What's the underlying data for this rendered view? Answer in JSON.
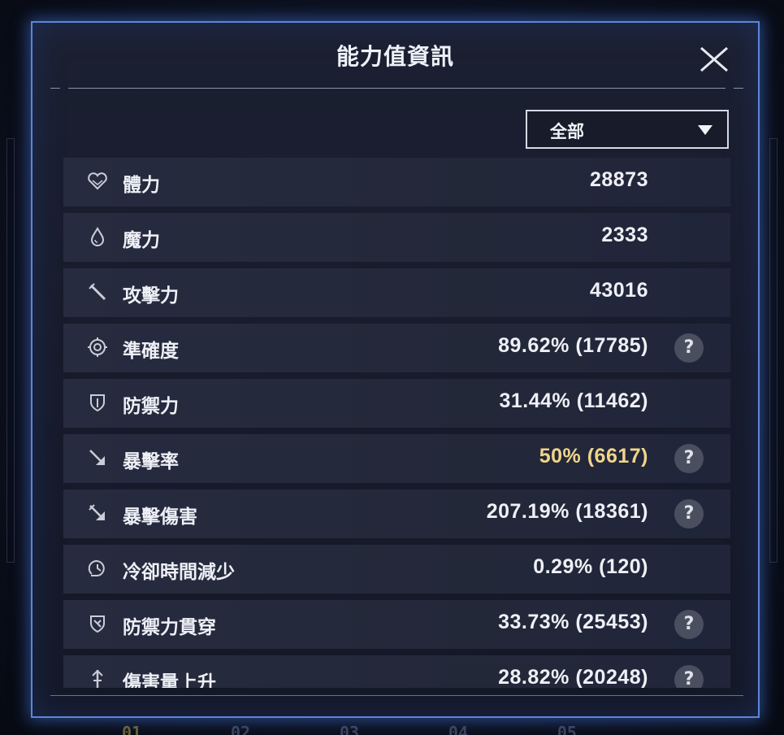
{
  "background": {
    "bottom_tab_numbers": [
      "01",
      "02",
      "03",
      "04",
      "05"
    ]
  },
  "panel": {
    "title": "能力值資訊",
    "close_icon": "close-x-icon"
  },
  "filter": {
    "selected": "全部",
    "arrow_icon": "triangle-down-icon"
  },
  "stats": [
    {
      "icon": "heart-icon",
      "label": "體力",
      "value": "28873",
      "help": false,
      "highlight": false
    },
    {
      "icon": "droplet-icon",
      "label": "魔力",
      "value": "2333",
      "help": false,
      "highlight": false
    },
    {
      "icon": "sword-icon",
      "label": "攻擊力",
      "value": "43016",
      "help": false,
      "highlight": false
    },
    {
      "icon": "target-icon",
      "label": "準確度",
      "value": "89.62% (17785)",
      "help": true,
      "highlight": false
    },
    {
      "icon": "shield-icon",
      "label": "防禦力",
      "value": "31.44% (11462)",
      "help": false,
      "highlight": false
    },
    {
      "icon": "critical-arrow-icon",
      "label": "暴擊率",
      "value": "50% (6617)",
      "help": true,
      "highlight": true
    },
    {
      "icon": "critical-damage-icon",
      "label": "暴擊傷害",
      "value": "207.19% (18361)",
      "help": true,
      "highlight": false
    },
    {
      "icon": "cooldown-icon",
      "label": "冷卻時間減少",
      "value": "0.29% (120)",
      "help": false,
      "highlight": false
    },
    {
      "icon": "shield-pierce-icon",
      "label": "防禦力貫穿",
      "value": "33.73% (25453)",
      "help": true,
      "highlight": false
    },
    {
      "icon": "damage-up-icon",
      "label": "傷害量上升",
      "value": "28.82% (20248)",
      "help": true,
      "highlight": false
    }
  ],
  "help_label": "?",
  "colors": {
    "panel_border": "#5b86d8",
    "highlight_value": "#f0d58a",
    "row_bg": "#262b3f",
    "help_bg": "#4a4f60"
  }
}
